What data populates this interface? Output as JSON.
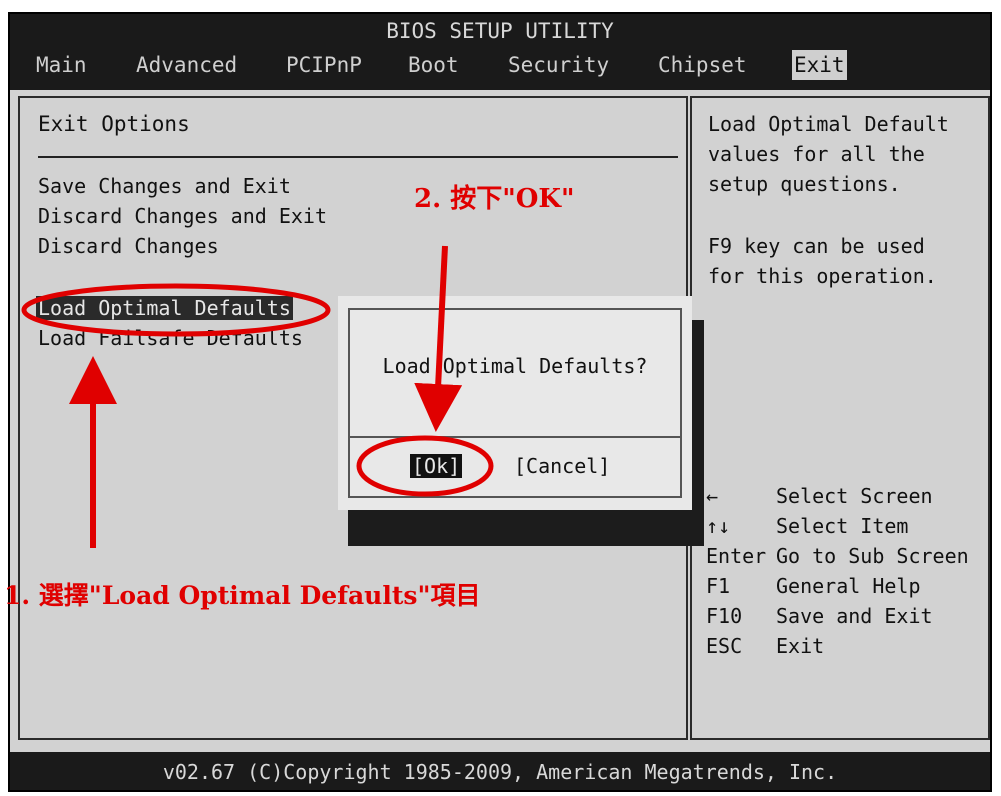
{
  "window": {
    "title": "BIOS SETUP UTILITY"
  },
  "menu": {
    "tabs": [
      {
        "label": "Main"
      },
      {
        "label": "Advanced"
      },
      {
        "label": "PCIPnP"
      },
      {
        "label": "Boot"
      },
      {
        "label": "Security"
      },
      {
        "label": "Chipset"
      },
      {
        "label": "Exit",
        "active": true
      }
    ]
  },
  "exit_panel": {
    "title": "Exit Options",
    "options": [
      {
        "label": "Save Changes and Exit"
      },
      {
        "label": "Discard Changes and Exit"
      },
      {
        "label": "Discard Changes"
      },
      {
        "label": "Load Optimal Defaults",
        "selected": true
      },
      {
        "label": "Load Failsafe Defaults"
      }
    ]
  },
  "help_panel": {
    "description": [
      "Load Optimal Default",
      "values for all the",
      "setup questions."
    ],
    "tip": [
      "F9 key can be used",
      "for this operation."
    ],
    "keys": [
      {
        "key": "←",
        "action": "Select Screen"
      },
      {
        "key": "↑↓",
        "action": "Select Item"
      },
      {
        "key": "Enter",
        "action": "Go to Sub Screen"
      },
      {
        "key": "F1",
        "action": "General Help"
      },
      {
        "key": "F10",
        "action": "Save and Exit"
      },
      {
        "key": "ESC",
        "action": "Exit"
      }
    ]
  },
  "dialog": {
    "message": "Load Optimal Defaults?",
    "ok_label": "[Ok]",
    "cancel_label": "[Cancel]"
  },
  "footer": {
    "text": "v02.67 (C)Copyright 1985-2009, American Megatrends, Inc."
  },
  "annotations": {
    "step1": "1. 選擇\"Load Optimal Defaults\"項目",
    "step2": "2. 按下\"OK\"",
    "color": "#e00000"
  }
}
